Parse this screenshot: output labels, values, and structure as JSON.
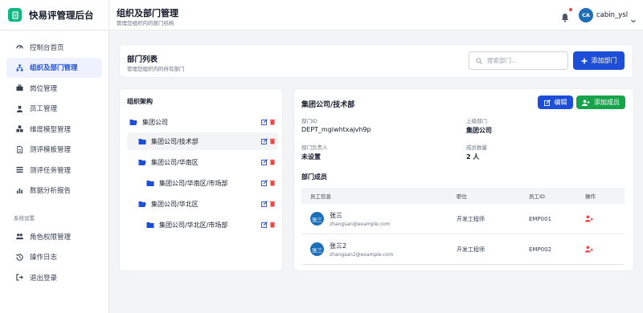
{
  "app": {
    "title": "快易评管理后台",
    "brand_color": "#10b981"
  },
  "sidebar": {
    "items": [
      {
        "label": "控制台首页",
        "icon": "dashboard-icon"
      },
      {
        "label": "组织及部门管理",
        "icon": "org-chart-icon",
        "active": true
      },
      {
        "label": "岗位管理",
        "icon": "briefcase-icon"
      },
      {
        "label": "员工管理",
        "icon": "user-icon"
      },
      {
        "label": "维度模型管理",
        "icon": "cubes-icon"
      },
      {
        "label": "测评模板管理",
        "icon": "file-icon"
      },
      {
        "label": "测评任务管理",
        "icon": "task-list-icon"
      },
      {
        "label": "数据分析报告",
        "icon": "bar-chart-icon"
      }
    ],
    "section_title": "系统设置",
    "system_items": [
      {
        "label": "角色权限管理",
        "icon": "users-cog-icon"
      },
      {
        "label": "操作日志",
        "icon": "history-icon"
      },
      {
        "label": "退出登录",
        "icon": "logout-icon"
      }
    ]
  },
  "header": {
    "title": "组织及部门管理",
    "subtitle": "管理您组织内的部门结构",
    "user": {
      "initials": "CA",
      "name": "cabin_ysl"
    }
  },
  "dept_list": {
    "title": "部门列表",
    "subtitle": "管理您组织内的所有部门",
    "search_placeholder": "搜索部门...",
    "add_button": "添加部门"
  },
  "tree": {
    "title": "组织架构",
    "nodes": [
      {
        "label": "集团公司",
        "level": 0,
        "open": true
      },
      {
        "label": "集团公司/技术部",
        "level": 1,
        "selected": true
      },
      {
        "label": "集团公司/华南区",
        "level": 1,
        "open": true
      },
      {
        "label": "集团公司/华南区/市场部",
        "level": 2
      },
      {
        "label": "集团公司/华北区",
        "level": 1,
        "open": true
      },
      {
        "label": "集团公司/华北区/市场部",
        "level": 2
      }
    ]
  },
  "detail": {
    "title": "集团公司/技术部",
    "edit_button": "编辑",
    "add_member_button": "添加成员",
    "fields": {
      "id_label": "部门ID",
      "id_value": "DEPT_mgiwhtxajvh9p",
      "parent_label": "上级部门",
      "parent_value": "集团公司",
      "head_label": "部门负责人",
      "head_value": "未设置",
      "count_label": "成员数量",
      "count_value": "2 人"
    },
    "members_title": "部门成员",
    "columns": [
      "员工信息",
      "职位",
      "员工ID",
      "操作"
    ],
    "members": [
      {
        "avatar": "张三",
        "name": "张三",
        "email": "zhangsan@example.com",
        "position": "开发工程师",
        "emp_id": "EMP001"
      },
      {
        "avatar": "张三",
        "name": "张三2",
        "email": "zhangsan2@example.com",
        "position": "开发工程师",
        "emp_id": "EMP002"
      }
    ]
  },
  "colors": {
    "primary": "#1d4ed8",
    "success": "#16a34a",
    "danger": "#ef4444",
    "avatar": "#1d6fb8"
  }
}
